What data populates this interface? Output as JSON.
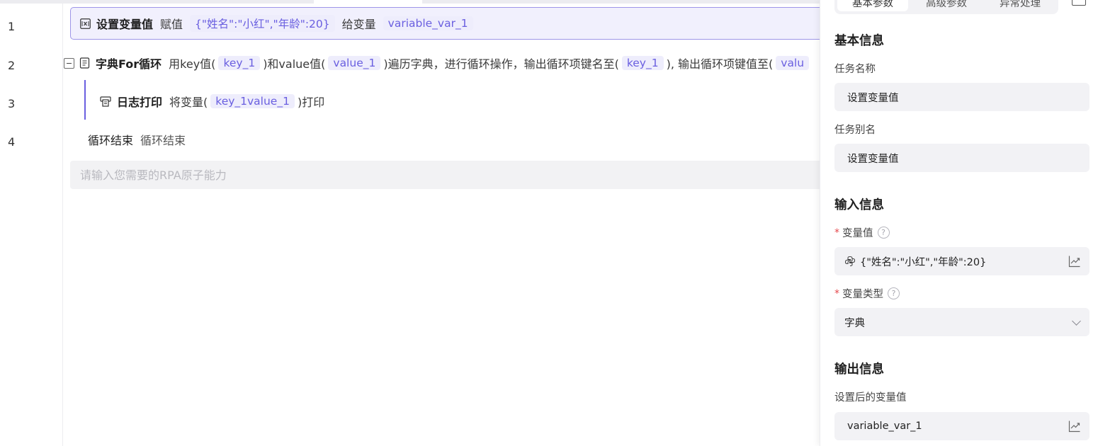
{
  "gutter": {
    "line_numbers": [
      "1",
      "2",
      "3",
      "4"
    ]
  },
  "editor": {
    "row1": {
      "title": "设置变量值",
      "t1": "赋值",
      "chip1": "{\"姓名\":\"小红\",\"年龄\":20}",
      "t2": "给变量",
      "chip2": "variable_var_1"
    },
    "row2": {
      "title": "字典For循环",
      "t1": "用key值(",
      "chip1": "key_1",
      "t2": ")和value值(",
      "chip2": "value_1",
      "t3": ")遍历字典，进行循环操作，输出循环项键名至(",
      "chip3": "key_1",
      "t4": "), 输出循环项键值至(",
      "chip4": "valu"
    },
    "row3": {
      "title": "日志打印",
      "t1": "将变量(",
      "chip1": "key_1value_1",
      "t2": ")打印"
    },
    "row4": {
      "title": "循环结束",
      "t1": "循环结束"
    },
    "input_placeholder": "请输入您需要的RPA原子能力"
  },
  "panel": {
    "tabs": [
      "基本参数",
      "高级参数",
      "异常处理"
    ],
    "active_tab": "基本参数",
    "basic_info": {
      "title": "基本信息",
      "task_name_label": "任务名称",
      "task_name_value": "设置变量值",
      "task_alias_label": "任务别名",
      "task_alias_value": "设置变量值"
    },
    "input_info": {
      "title": "输入信息",
      "var_value_label": "变量值",
      "var_value": "{\"姓名\":\"小红\",\"年龄\":20}",
      "var_type_label": "变量类型",
      "var_type_value": "字典",
      "required_mark": "*",
      "help_glyph": "?"
    },
    "output_info": {
      "title": "输出信息",
      "out_label": "设置后的变量值",
      "out_value": "variable_var_1"
    }
  },
  "icons": {
    "set-variable": "variable-x-icon",
    "dict-loop": "loop-doc-icon",
    "log-print": "printer-icon",
    "python": "python-icon",
    "chart": "trend-chart-icon",
    "expand": "expand-panel-icon"
  },
  "colors": {
    "accent": "#6a5fe0",
    "chip_bg": "#eeedfc",
    "selected_bg": "#f1f0fd",
    "required": "#e5484d"
  }
}
